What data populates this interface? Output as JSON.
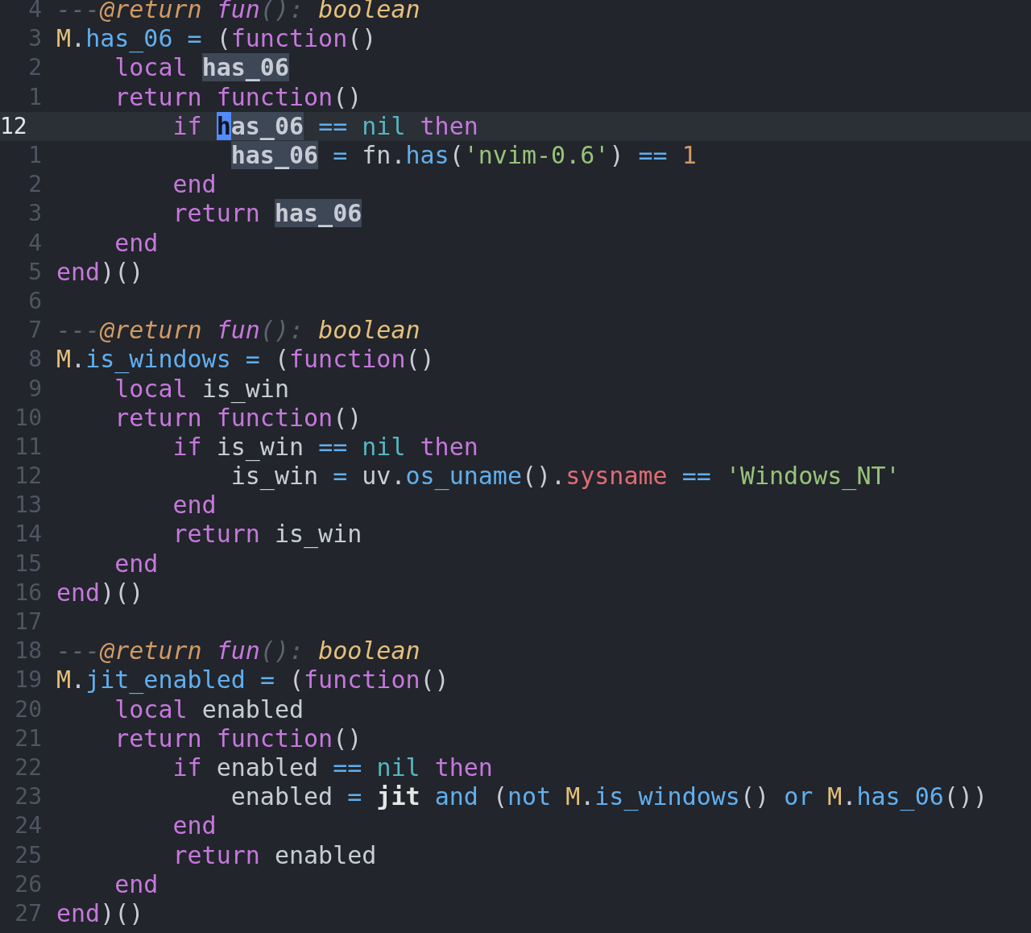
{
  "editor": {
    "lines": [
      {
        "number": "4",
        "current": false,
        "tokens": [
          {
            "text": "---",
            "kind": "comment"
          },
          {
            "text": "@return ",
            "kind": "tag"
          },
          {
            "text": "fun",
            "kind": "comment_keyword"
          },
          {
            "text": "(): ",
            "kind": "comment"
          },
          {
            "text": "boolean",
            "kind": "type"
          }
        ]
      },
      {
        "number": "3",
        "current": false,
        "tokens": [
          {
            "text": "M",
            "kind": "module"
          },
          {
            "text": ".",
            "kind": "plain"
          },
          {
            "text": "has_06 ",
            "kind": "member"
          },
          {
            "text": "=",
            "kind": "op"
          },
          {
            "text": " (",
            "kind": "plain"
          },
          {
            "text": "function",
            "kind": "keyword"
          },
          {
            "text": "()",
            "kind": "plain"
          }
        ]
      },
      {
        "number": "2",
        "current": false,
        "tokens": [
          {
            "text": "    local ",
            "kind": "keyword"
          },
          {
            "text": "has_06",
            "kind": "match"
          }
        ]
      },
      {
        "number": "1",
        "current": false,
        "tokens": [
          {
            "text": "    return function",
            "kind": "keyword"
          },
          {
            "text": "()",
            "kind": "plain"
          }
        ]
      },
      {
        "number": "12",
        "current": true,
        "tokens": [
          {
            "text": "        if ",
            "kind": "keyword"
          },
          {
            "text": "h",
            "kind": "cursor"
          },
          {
            "text": "as_06",
            "kind": "match"
          },
          {
            "text": " ==",
            "kind": "op"
          },
          {
            "text": " nil",
            "kind": "builtin"
          },
          {
            "text": " then",
            "kind": "keyword"
          }
        ]
      },
      {
        "number": "1",
        "current": false,
        "tokens": [
          {
            "text": "            has_06",
            "kind": "match"
          },
          {
            "text": " =",
            "kind": "op"
          },
          {
            "text": " fn.",
            "kind": "plain"
          },
          {
            "text": "has",
            "kind": "member"
          },
          {
            "text": "(",
            "kind": "plain"
          },
          {
            "text": "'nvim-0.6'",
            "kind": "string"
          },
          {
            "text": ") ",
            "kind": "plain"
          },
          {
            "text": "== ",
            "kind": "op"
          },
          {
            "text": "1",
            "kind": "number"
          }
        ]
      },
      {
        "number": "2",
        "current": false,
        "tokens": [
          {
            "text": "        end",
            "kind": "keyword"
          }
        ]
      },
      {
        "number": "3",
        "current": false,
        "tokens": [
          {
            "text": "        return ",
            "kind": "keyword"
          },
          {
            "text": "has_06",
            "kind": "match"
          }
        ]
      },
      {
        "number": "4",
        "current": false,
        "tokens": [
          {
            "text": "    end",
            "kind": "keyword"
          }
        ]
      },
      {
        "number": "5",
        "current": false,
        "tokens": [
          {
            "text": "end",
            "kind": "keyword"
          },
          {
            "text": ")()",
            "kind": "plain"
          }
        ]
      },
      {
        "number": "6",
        "current": false
      },
      {
        "number": "7",
        "current": false,
        "tokens": [
          {
            "text": "---",
            "kind": "comment"
          },
          {
            "text": "@return ",
            "kind": "tag"
          },
          {
            "text": "fun",
            "kind": "comment_keyword"
          },
          {
            "text": "(): ",
            "kind": "comment"
          },
          {
            "text": "boolean",
            "kind": "type"
          }
        ]
      },
      {
        "number": "8",
        "current": false,
        "tokens": [
          {
            "text": "M",
            "kind": "module"
          },
          {
            "text": ".",
            "kind": "plain"
          },
          {
            "text": "is_windows ",
            "kind": "member"
          },
          {
            "text": "=",
            "kind": "op"
          },
          {
            "text": " (",
            "kind": "plain"
          },
          {
            "text": "function",
            "kind": "keyword"
          },
          {
            "text": "()",
            "kind": "plain"
          }
        ]
      },
      {
        "number": "9",
        "current": false,
        "tokens": [
          {
            "text": "    local",
            "kind": "keyword"
          },
          {
            "text": " is_win",
            "kind": "plain"
          }
        ]
      },
      {
        "number": "10",
        "current": false,
        "tokens": [
          {
            "text": "    return function",
            "kind": "keyword"
          },
          {
            "text": "()",
            "kind": "plain"
          }
        ]
      },
      {
        "number": "11",
        "current": false,
        "tokens": [
          {
            "text": "        if",
            "kind": "keyword"
          },
          {
            "text": " is_win ",
            "kind": "plain"
          },
          {
            "text": "==",
            "kind": "op"
          },
          {
            "text": " nil",
            "kind": "builtin"
          },
          {
            "text": " then",
            "kind": "keyword"
          }
        ]
      },
      {
        "number": "12",
        "current": false,
        "tokens": [
          {
            "text": "            is_win ",
            "kind": "plain"
          },
          {
            "text": "=",
            "kind": "op"
          },
          {
            "text": " uv.",
            "kind": "plain"
          },
          {
            "text": "os_uname",
            "kind": "member"
          },
          {
            "text": "().",
            "kind": "plain"
          },
          {
            "text": "sysname ",
            "kind": "field"
          },
          {
            "text": "== ",
            "kind": "op"
          },
          {
            "text": "'Windows_NT'",
            "kind": "string"
          }
        ]
      },
      {
        "number": "13",
        "current": false,
        "tokens": [
          {
            "text": "        end",
            "kind": "keyword"
          }
        ]
      },
      {
        "number": "14",
        "current": false,
        "tokens": [
          {
            "text": "        return",
            "kind": "keyword"
          },
          {
            "text": " is_win",
            "kind": "plain"
          }
        ]
      },
      {
        "number": "15",
        "current": false,
        "tokens": [
          {
            "text": "    end",
            "kind": "keyword"
          }
        ]
      },
      {
        "number": "16",
        "current": false,
        "tokens": [
          {
            "text": "end",
            "kind": "keyword"
          },
          {
            "text": ")()",
            "kind": "plain"
          }
        ]
      },
      {
        "number": "17",
        "current": false
      },
      {
        "number": "18",
        "current": false,
        "tokens": [
          {
            "text": "---",
            "kind": "comment"
          },
          {
            "text": "@return ",
            "kind": "tag"
          },
          {
            "text": "fun",
            "kind": "comment_keyword"
          },
          {
            "text": "(): ",
            "kind": "comment"
          },
          {
            "text": "boolean",
            "kind": "type"
          }
        ]
      },
      {
        "number": "19",
        "current": false,
        "tokens": [
          {
            "text": "M",
            "kind": "module"
          },
          {
            "text": ".",
            "kind": "plain"
          },
          {
            "text": "jit_enabled ",
            "kind": "member"
          },
          {
            "text": "=",
            "kind": "op"
          },
          {
            "text": " (",
            "kind": "plain"
          },
          {
            "text": "function",
            "kind": "keyword"
          },
          {
            "text": "()",
            "kind": "plain"
          }
        ]
      },
      {
        "number": "20",
        "current": false,
        "tokens": [
          {
            "text": "    local",
            "kind": "keyword"
          },
          {
            "text": " enabled",
            "kind": "plain"
          }
        ]
      },
      {
        "number": "21",
        "current": false,
        "tokens": [
          {
            "text": "    return function",
            "kind": "keyword"
          },
          {
            "text": "()",
            "kind": "plain"
          }
        ]
      },
      {
        "number": "22",
        "current": false,
        "tokens": [
          {
            "text": "        if",
            "kind": "keyword"
          },
          {
            "text": " enabled ",
            "kind": "plain"
          },
          {
            "text": "==",
            "kind": "op"
          },
          {
            "text": " nil",
            "kind": "builtin"
          },
          {
            "text": " then",
            "kind": "keyword"
          }
        ]
      },
      {
        "number": "23",
        "current": false,
        "tokens": [
          {
            "text": "            enabled ",
            "kind": "plain"
          },
          {
            "text": "=",
            "kind": "op"
          },
          {
            "text": " jit",
            "kind": "bold"
          },
          {
            "text": " and",
            "kind": "op"
          },
          {
            "text": " (",
            "kind": "plain"
          },
          {
            "text": "not ",
            "kind": "op"
          },
          {
            "text": "M",
            "kind": "module"
          },
          {
            "text": ".",
            "kind": "plain"
          },
          {
            "text": "is_windows",
            "kind": "member"
          },
          {
            "text": "() ",
            "kind": "plain"
          },
          {
            "text": "or ",
            "kind": "op"
          },
          {
            "text": "M",
            "kind": "module"
          },
          {
            "text": ".",
            "kind": "plain"
          },
          {
            "text": "has_06",
            "kind": "member"
          },
          {
            "text": "())",
            "kind": "plain"
          }
        ]
      },
      {
        "number": "24",
        "current": false,
        "tokens": [
          {
            "text": "        end",
            "kind": "keyword"
          }
        ]
      },
      {
        "number": "25",
        "current": false,
        "tokens": [
          {
            "text": "        return",
            "kind": "keyword"
          },
          {
            "text": " enabled",
            "kind": "plain"
          }
        ]
      },
      {
        "number": "26",
        "current": false,
        "tokens": [
          {
            "text": "    end",
            "kind": "keyword"
          }
        ]
      },
      {
        "number": "27",
        "current": false,
        "tokens": [
          {
            "text": "end",
            "kind": "keyword"
          },
          {
            "text": ")()",
            "kind": "plain"
          }
        ]
      }
    ]
  }
}
